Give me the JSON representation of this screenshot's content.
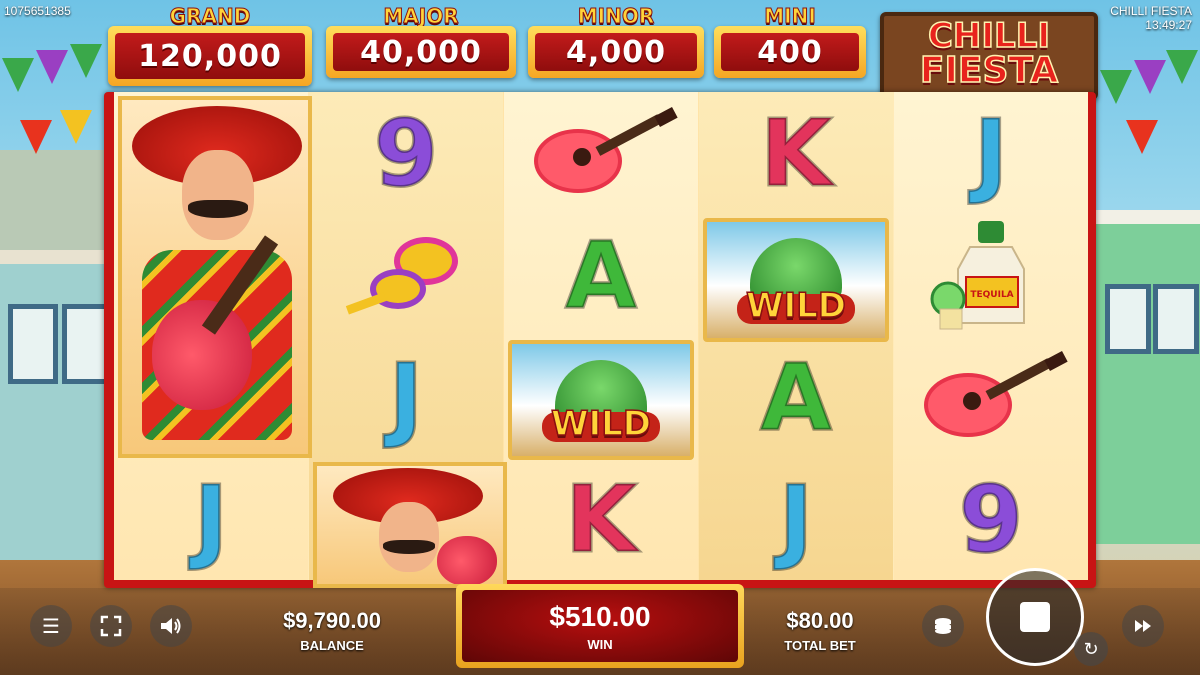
{
  "session_id": "1075651385",
  "game_title": "CHILLI FIESTA",
  "clock": "13:49:27",
  "logo": {
    "line1": "CHILLI",
    "line2": "FIESTA"
  },
  "jackpots": [
    {
      "name": "GRAND",
      "value": "120,000"
    },
    {
      "name": "MAJOR",
      "value": "40,000"
    },
    {
      "name": "MINOR",
      "value": "4,000"
    },
    {
      "name": "MINI",
      "value": "400"
    }
  ],
  "reels": {
    "col1": {
      "top": "mariachi",
      "bottom": "J"
    },
    "col2": {
      "row1": "9",
      "row2": "maracas",
      "row3": "J",
      "row4": "mariachi"
    },
    "col3": {
      "row1": "guitar",
      "row2": "A",
      "row3": "WILD",
      "row4": "K"
    },
    "col4": {
      "row1": "K",
      "row2": "WILD",
      "row3": "A",
      "row4": "J"
    },
    "col5": {
      "row1": "J",
      "row2": "tequila",
      "row3": "guitar",
      "row4": "9"
    }
  },
  "wild_label": "WILD",
  "tequila_label": "TEQUILA",
  "controls": {
    "menu_icon": "menu-icon",
    "fullscreen_icon": "fullscreen-icon",
    "sound_icon": "sound-icon",
    "coins_icon": "coins-icon",
    "spin_icon": "stop-icon",
    "autoplay_icon": "autoplay-icon",
    "turbo_icon": "fast-forward-icon"
  },
  "balance": {
    "amount": "$9,790.00",
    "label": "BALANCE"
  },
  "win": {
    "amount": "$510.00",
    "label": "WIN"
  },
  "total_bet": {
    "amount": "$80.00",
    "label": "TOTAL BET"
  },
  "colors": {
    "reel_frame": "#c81414",
    "jackpot_gold": "#ffd43a",
    "jackpot_red": "#c21b1b",
    "letter_9": "#8b4dd8",
    "letter_K": "#e3345c",
    "letter_A": "#3fb83a",
    "letter_J": "#3ab0e0"
  }
}
